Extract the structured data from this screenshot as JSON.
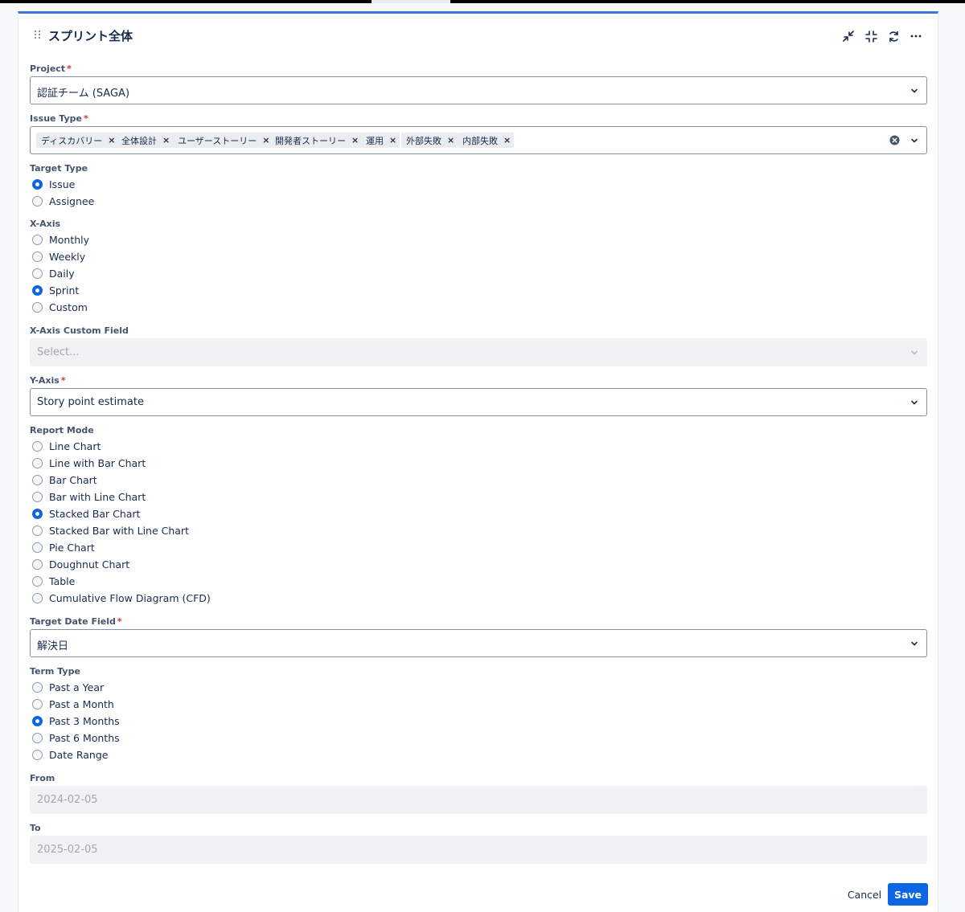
{
  "panel": {
    "title": "スプリント全体",
    "header_icons": [
      "collapse-arrows-icon",
      "minimize-icon",
      "refresh-icon",
      "more-icon"
    ]
  },
  "project": {
    "label": "Project",
    "required": "*",
    "value": "認証チーム (SAGA)"
  },
  "issue_type": {
    "label": "Issue Type",
    "required": "*",
    "tags": [
      "ディスカバリー",
      "全体設計",
      "ユーザーストーリー",
      "開発者ストーリー",
      "運用",
      "外部失敗",
      "内部失敗"
    ],
    "remove_glyph": "×"
  },
  "target_type": {
    "label": "Target Type",
    "options": [
      "Issue",
      "Assignee"
    ],
    "selected": "Issue"
  },
  "x_axis": {
    "label": "X-Axis",
    "options": [
      "Monthly",
      "Weekly",
      "Daily",
      "Sprint",
      "Custom"
    ],
    "selected": "Sprint"
  },
  "x_axis_custom_field": {
    "label": "X-Axis Custom Field",
    "placeholder": "Select..."
  },
  "y_axis": {
    "label": "Y-Axis",
    "required": "*",
    "value": "Story point estimate"
  },
  "report_mode": {
    "label": "Report Mode",
    "options": [
      "Line Chart",
      "Line with Bar Chart",
      "Bar Chart",
      "Bar with Line Chart",
      "Stacked Bar Chart",
      "Stacked Bar with Line Chart",
      "Pie Chart",
      "Doughnut Chart",
      "Table",
      "Cumulative Flow Diagram (CFD)"
    ],
    "selected": "Stacked Bar Chart"
  },
  "target_date_field": {
    "label": "Target Date Field",
    "required": "*",
    "value": "解決日"
  },
  "term_type": {
    "label": "Term Type",
    "options": [
      "Past a Year",
      "Past a Month",
      "Past 3 Months",
      "Past 6 Months",
      "Date Range"
    ],
    "selected": "Past 3 Months"
  },
  "from": {
    "label": "From",
    "value": "2024-02-05"
  },
  "to": {
    "label": "To",
    "value": "2025-02-05"
  },
  "actions": {
    "cancel": "Cancel",
    "save": "Save"
  },
  "colors": {
    "accent": "#0c66e4",
    "header_border": "#3c79dc",
    "required": "#c9372c"
  }
}
